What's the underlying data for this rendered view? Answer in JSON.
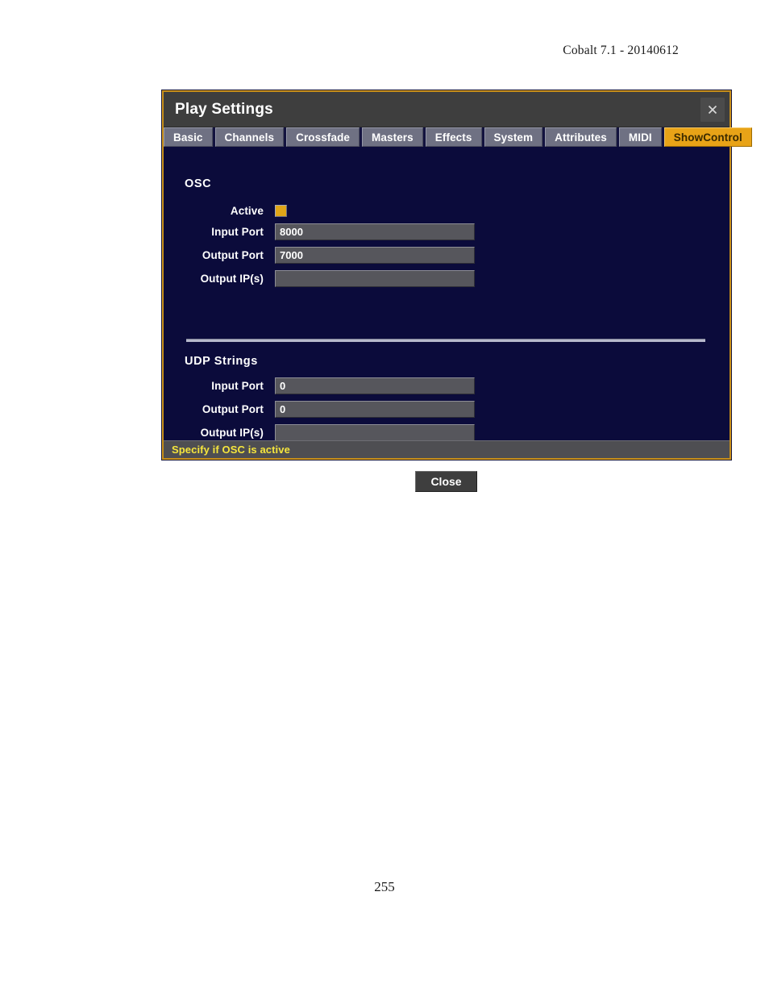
{
  "document": {
    "header": "Cobalt 7.1 - 20140612",
    "page_number": "255"
  },
  "dialog": {
    "title": "Play Settings",
    "close_icon": "close-x-icon",
    "tabs": [
      {
        "label": "Basic",
        "selected": false
      },
      {
        "label": "Channels",
        "selected": false
      },
      {
        "label": "Crossfade",
        "selected": false
      },
      {
        "label": "Masters",
        "selected": false
      },
      {
        "label": "Effects",
        "selected": false
      },
      {
        "label": "System",
        "selected": false
      },
      {
        "label": "Attributes",
        "selected": false
      },
      {
        "label": "MIDI",
        "selected": false
      },
      {
        "label": "ShowControl",
        "selected": true
      }
    ],
    "osc": {
      "title": "OSC",
      "active_label": "Active",
      "active_checked": true,
      "input_port_label": "Input Port",
      "input_port_value": "8000",
      "output_port_label": "Output Port",
      "output_port_value": "7000",
      "output_ips_label": "Output IP(s)",
      "output_ips_value": ""
    },
    "udp": {
      "title": "UDP Strings",
      "input_port_label": "Input Port",
      "input_port_value": "0",
      "output_port_label": "Output Port",
      "output_port_value": "0",
      "output_ips_label": "Output IP(s)",
      "output_ips_value": ""
    },
    "close_button_label": "Close",
    "status_text": "Specify if OSC is active"
  },
  "colors": {
    "dialog_border": "#c8901a",
    "dialog_body": "#0b0b3b",
    "titlebar": "#3e3e3e",
    "tab_bg": "#6f7183",
    "tab_selected_bg": "#e8a317",
    "field_bg": "#56565c",
    "checkbox_on": "#e0a618",
    "status_text": "#f5e53d",
    "statusbar_bg": "#4e4e52"
  }
}
